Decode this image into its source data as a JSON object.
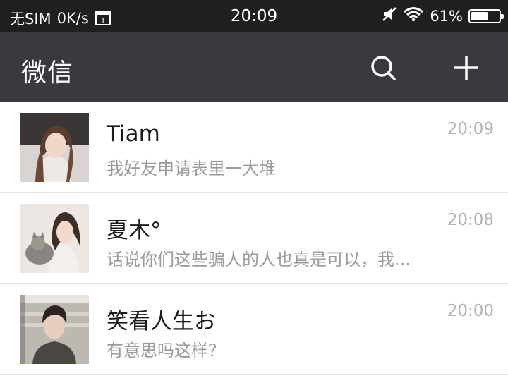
{
  "status_bar": {
    "carrier": "无SIM",
    "net_speed": "0K/s",
    "time": "20:09",
    "battery_percent_text": "61%",
    "battery_level": 0.61
  },
  "header": {
    "title": "微信",
    "search_icon": "search-icon",
    "add_icon": "plus-icon"
  },
  "chats": [
    {
      "name": "Tiam",
      "time": "20:09",
      "preview": "我好友申请表里一大堆"
    },
    {
      "name": "夏木°",
      "time": "20:08",
      "preview": "话说你们这些骗人的人也真是可以，我..."
    },
    {
      "name": "笑看人生お",
      "time": "20:00",
      "preview": "有意思吗这样？"
    }
  ],
  "colors": {
    "status_bar_bg": "#1f1f1f",
    "header_bg": "#393a3f",
    "divider": "#e2e2e2"
  }
}
